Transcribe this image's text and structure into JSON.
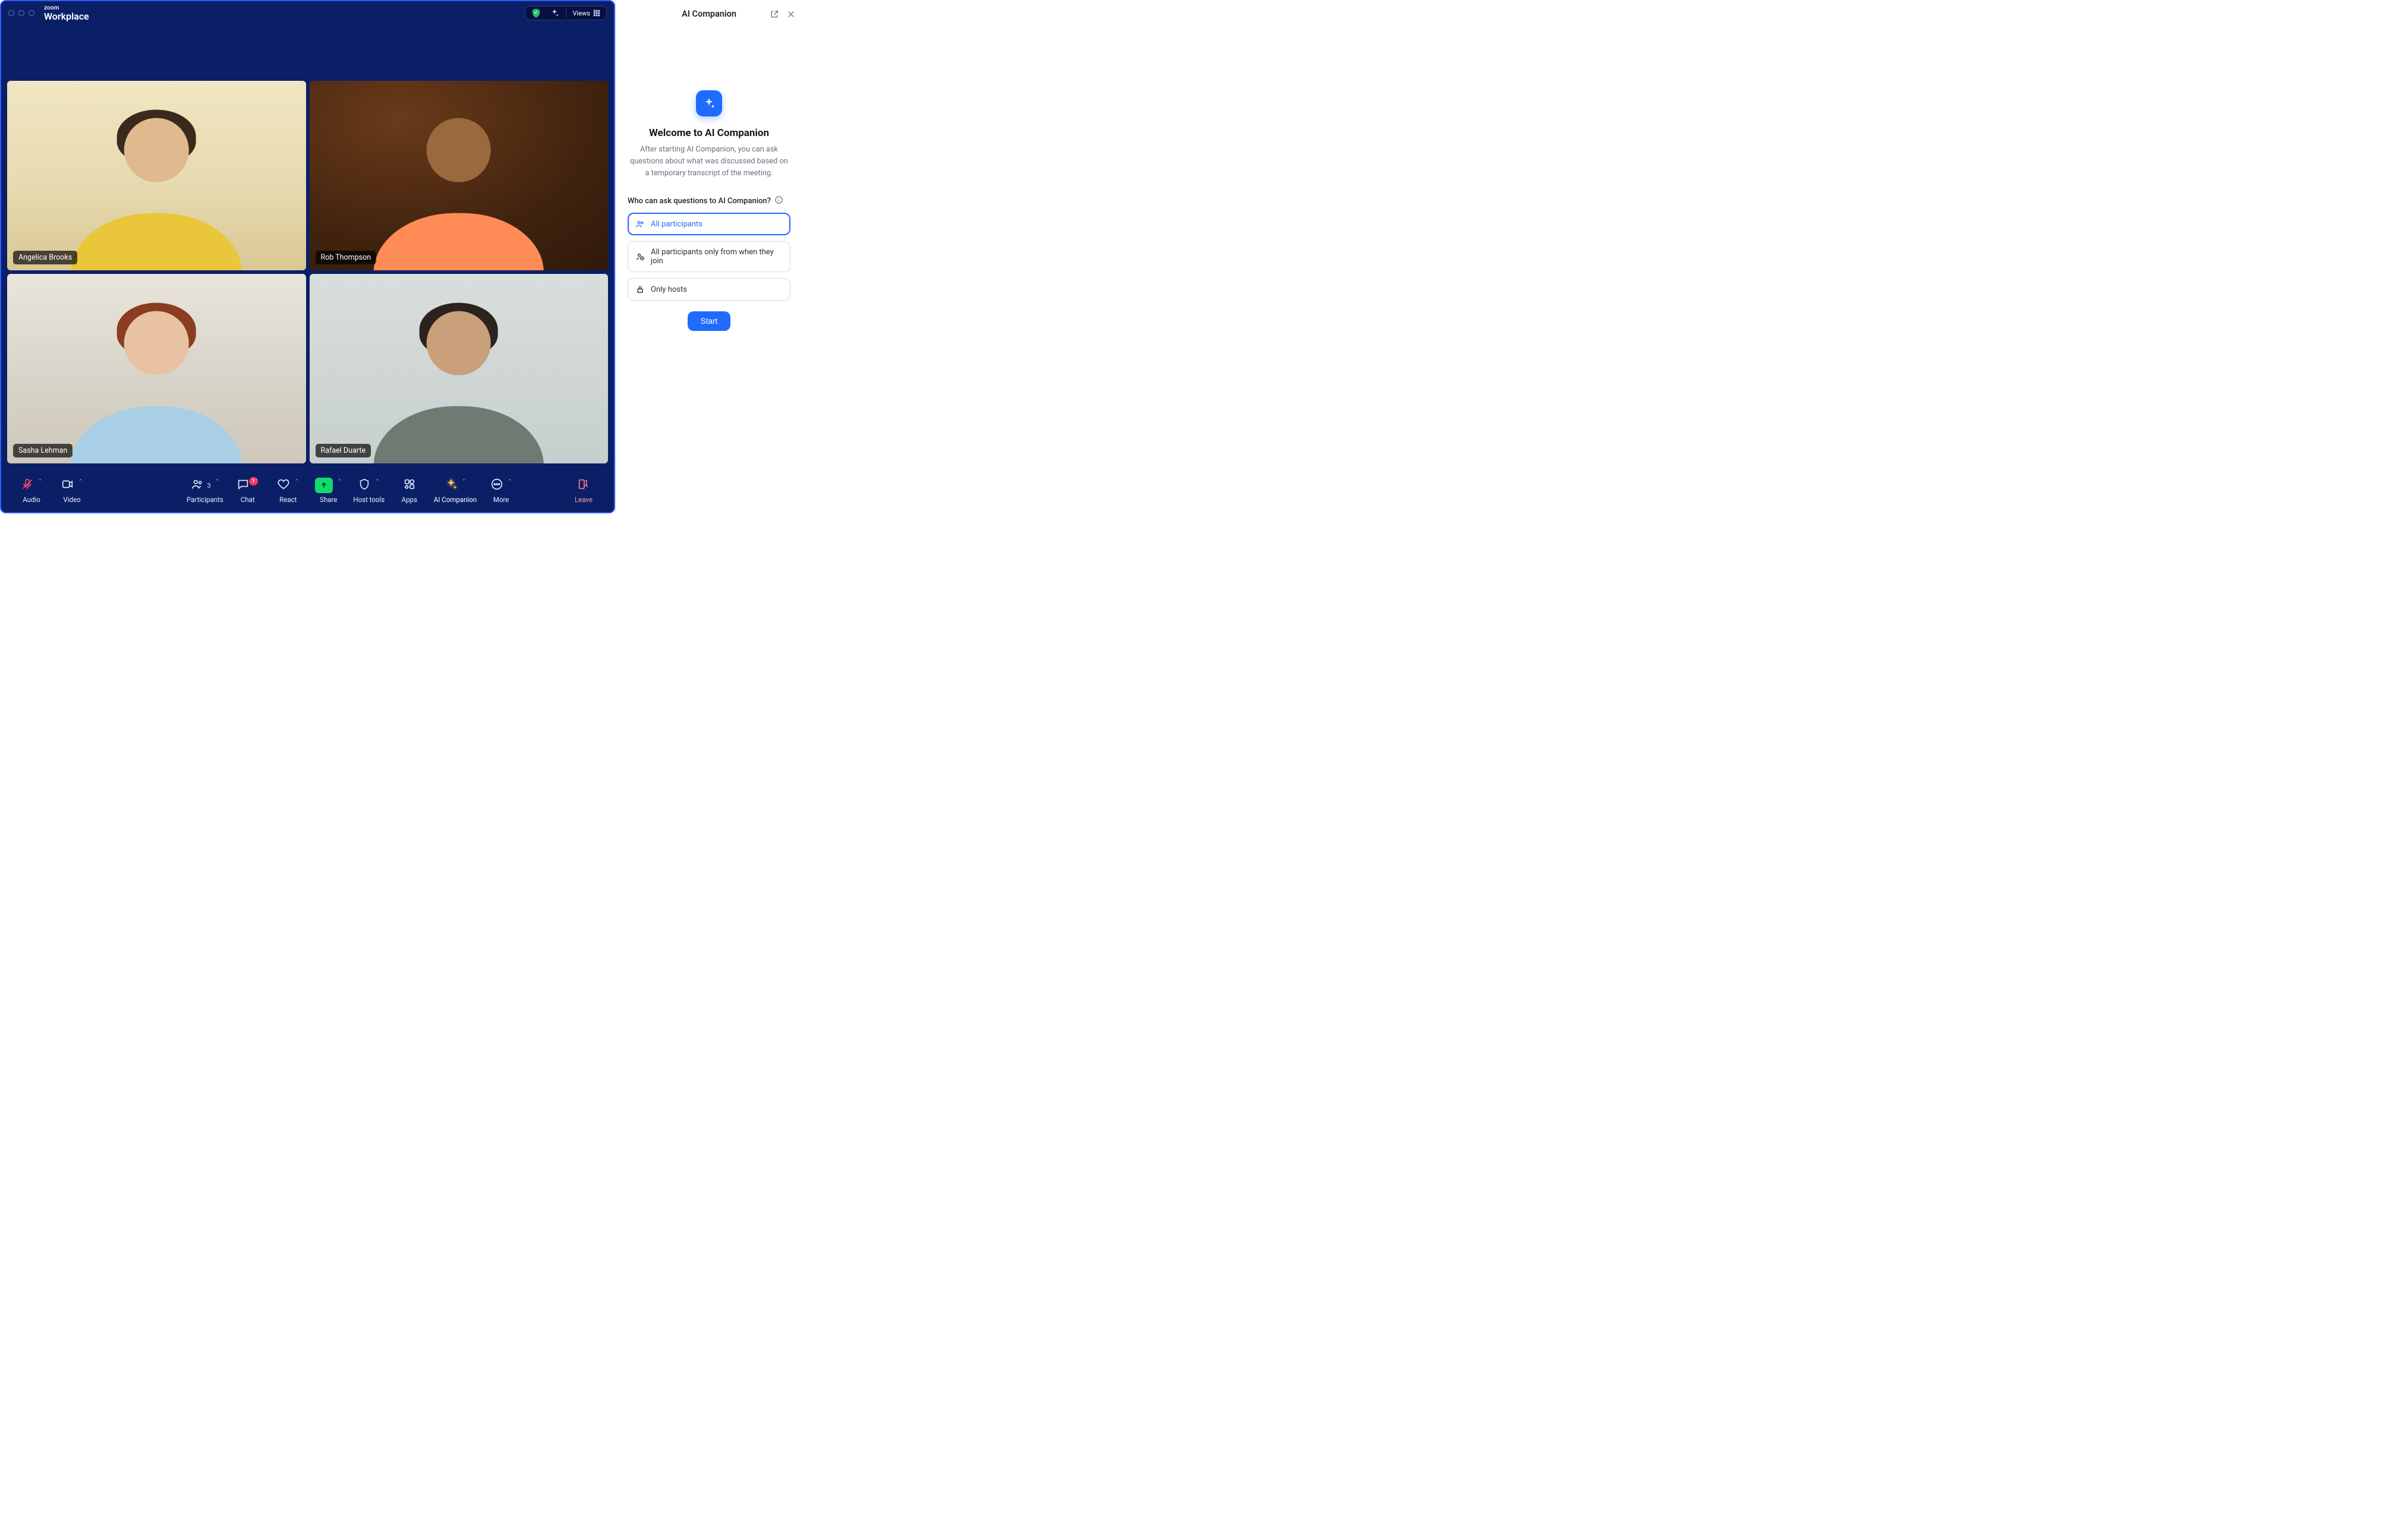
{
  "brand": {
    "top": "zoom",
    "bottom": "Workplace"
  },
  "titlebar": {
    "views_label": "Views"
  },
  "participants": [
    {
      "name": "Angelica Brooks"
    },
    {
      "name": "Rob Thompson"
    },
    {
      "name": "Sasha Lehman"
    },
    {
      "name": "Rafael Duarte"
    }
  ],
  "toolbar": {
    "audio": "Audio",
    "video": "Video",
    "participants": "Participants",
    "participants_count": "3",
    "chat": "Chat",
    "chat_badge": "1",
    "react": "React",
    "share": "Share",
    "host_tools": "Host tools",
    "apps": "Apps",
    "ai_companion": "AI Companion",
    "more": "More",
    "leave": "Leave"
  },
  "panel": {
    "title": "AI Companion",
    "welcome_heading": "Welcome to AI Companion",
    "welcome_body": "After starting AI Companion, you can ask questions about what was discussed based on a temporary transcript of the meeting.",
    "question": "Who can ask questions to AI Companion?",
    "options": [
      "All participants",
      "All participants only from when they join",
      "Only hosts"
    ],
    "start": "Start"
  }
}
